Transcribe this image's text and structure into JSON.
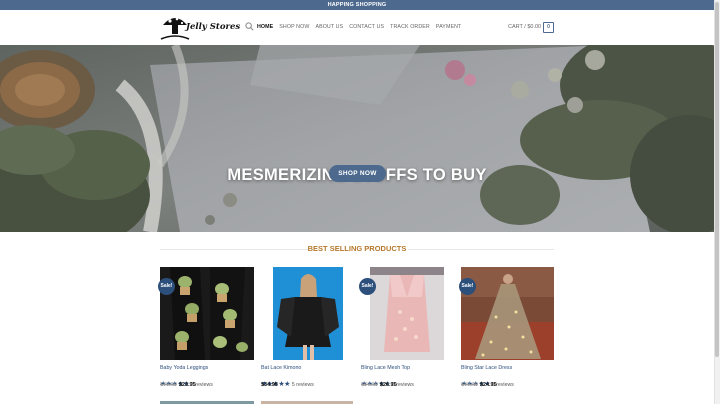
{
  "topbar": {
    "text": "HAPPING SHOPPING"
  },
  "header": {
    "logo_text": "Jelly Stores",
    "nav": [
      {
        "label": "HOME",
        "active": true
      },
      {
        "label": "SHOP NOW",
        "active": false
      },
      {
        "label": "ABOUT US",
        "active": false
      },
      {
        "label": "CONTACT US",
        "active": false
      },
      {
        "label": "TRACK ORDER",
        "active": false
      },
      {
        "label": "PAYMENT",
        "active": false
      }
    ],
    "cart_label": "CART / $0.00",
    "cart_count": "0",
    "icons": {
      "search": "search-icon",
      "logo": "mushroom-logo-icon"
    }
  },
  "hero": {
    "title": "MESMERIZING STUFFS TO BUY",
    "button_label": "SHOP NOW"
  },
  "section": {
    "title": "BEST SELLING PRODUCTS"
  },
  "products": [
    {
      "name": "Baby Yoda Leggings",
      "sale_label": "Sale!",
      "rating_stars": "★★★★★",
      "reviews": "7 reviews",
      "old_price": "$49.99",
      "price": "$23.95"
    },
    {
      "name": "Bat Lace Kimono",
      "sale_label": "",
      "rating_stars": "★★★★★",
      "reviews": "5 reviews",
      "old_price": "",
      "price": "$34.95"
    },
    {
      "name": "Bling Lace Mesh Top",
      "sale_label": "Sale!",
      "rating_stars": "★★★★★",
      "reviews": "6 reviews",
      "old_price": "$54.99",
      "price": "$26.95"
    },
    {
      "name": "Bling Star Lace Dress",
      "sale_label": "Sale!",
      "rating_stars": "★★★★★",
      "reviews": "6 reviews",
      "old_price": "$49.99",
      "price": "$24.95"
    }
  ],
  "colors": {
    "primary": "#4d6a8e",
    "link": "#2d4f7c",
    "section_title": "#b6782c"
  }
}
